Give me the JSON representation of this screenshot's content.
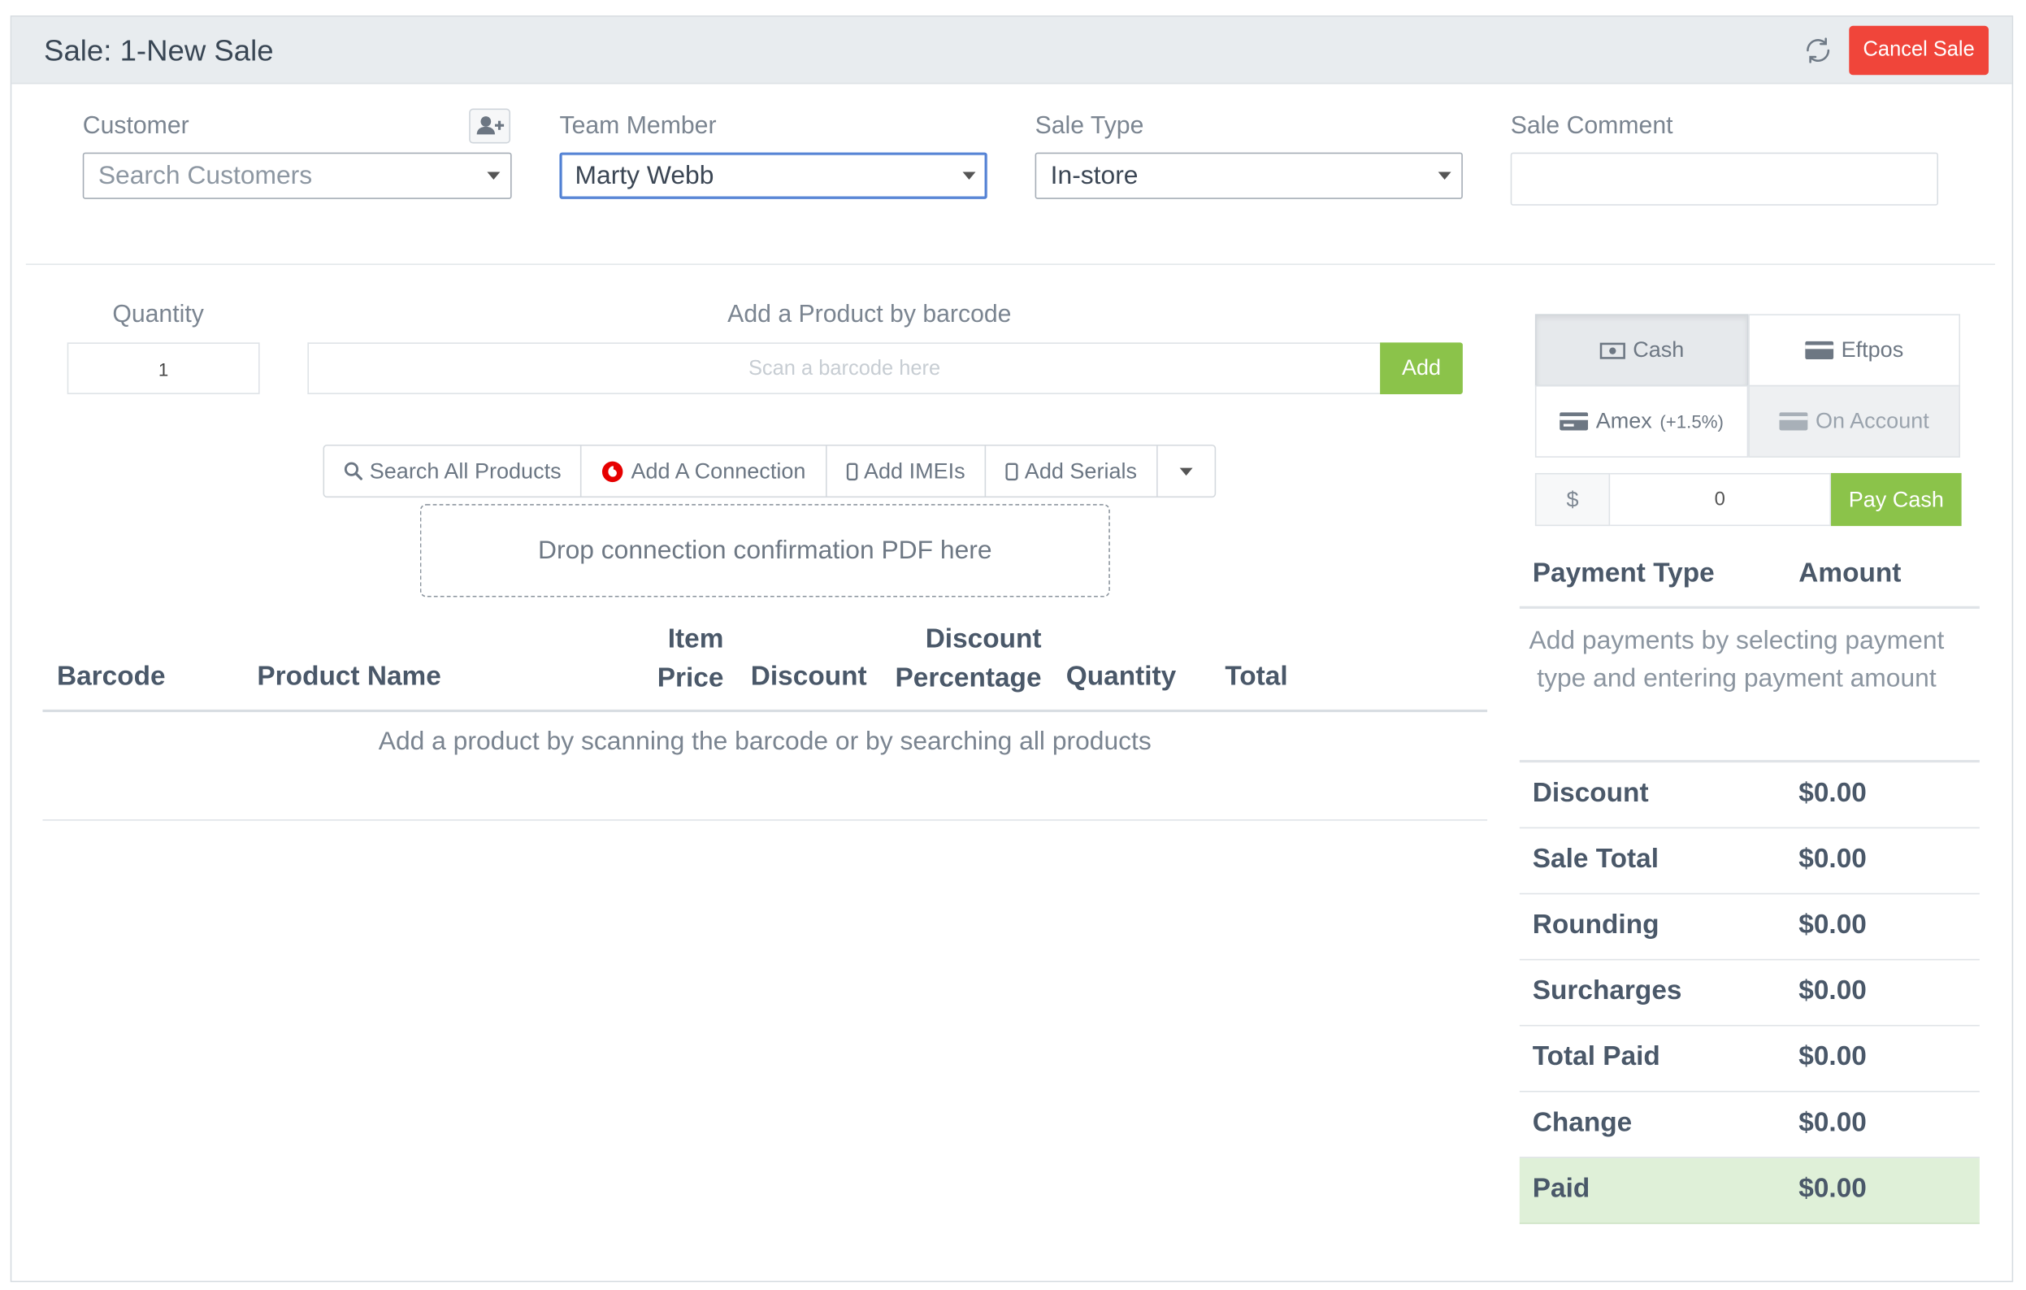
{
  "header": {
    "title": "Sale: 1-New Sale",
    "cancel_label": "Cancel Sale"
  },
  "form": {
    "customer": {
      "label": "Customer",
      "placeholder": "Search Customers"
    },
    "team_member": {
      "label": "Team Member",
      "value": "Marty Webb"
    },
    "sale_type": {
      "label": "Sale Type",
      "value": "In-store"
    },
    "sale_comment": {
      "label": "Sale Comment",
      "value": ""
    }
  },
  "product_entry": {
    "quantity_label": "Quantity",
    "quantity_value": "1",
    "barcode_label": "Add a Product by barcode",
    "barcode_placeholder": "Scan a barcode here",
    "add_label": "Add"
  },
  "actions": {
    "search_all": "Search All Products",
    "add_connection": "Add A Connection",
    "add_imeis": "Add IMEIs",
    "add_serials": "Add Serials"
  },
  "dropzone_text": "Drop connection confirmation PDF here",
  "table": {
    "headers": {
      "barcode": "Barcode",
      "product_name": "Product Name",
      "item_price_line1": "Item",
      "item_price_line2": "Price",
      "discount": "Discount",
      "discount_pct_line1": "Discount",
      "discount_pct_line2": "Percentage",
      "quantity": "Quantity",
      "total": "Total"
    },
    "empty_message": "Add a product by scanning the barcode or by searching all products"
  },
  "payment": {
    "methods": {
      "cash": "Cash",
      "eftpos": "Eftpos",
      "amex": "Amex",
      "amex_fee": "(+1.5%)",
      "on_account": "On Account"
    },
    "currency_symbol": "$",
    "amount_value": "0",
    "pay_button": "Pay Cash",
    "col_type": "Payment Type",
    "col_amount": "Amount",
    "help_text": "Add payments by selecting payment type and entering payment amount"
  },
  "summary": {
    "discount": {
      "label": "Discount",
      "value": "$0.00"
    },
    "sale_total": {
      "label": "Sale Total",
      "value": "$0.00"
    },
    "rounding": {
      "label": "Rounding",
      "value": "$0.00"
    },
    "surcharges": {
      "label": "Surcharges",
      "value": "$0.00"
    },
    "total_paid": {
      "label": "Total Paid",
      "value": "$0.00"
    },
    "change": {
      "label": "Change",
      "value": "$0.00"
    },
    "paid": {
      "label": "Paid",
      "value": "$0.00"
    }
  },
  "colors": {
    "cancel": "#f0453a",
    "success": "#8bc34a",
    "paid_row": "#dff0d8",
    "header_bg": "#e8ecef"
  }
}
